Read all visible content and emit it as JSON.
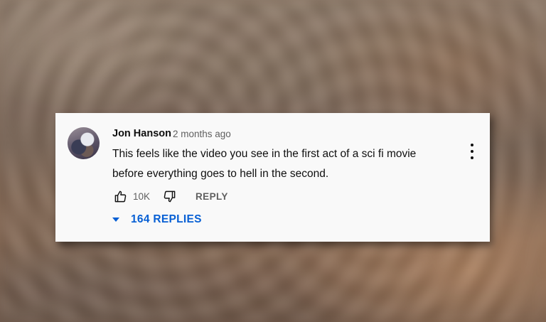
{
  "comment": {
    "author": "Jon Hanson",
    "timestamp": "2 months ago",
    "text": "This feels like the video you see in the first act of a sci fi movie before everything goes to hell in the second.",
    "like_count": "10K",
    "reply_label": "REPLY",
    "replies_label": "164 REPLIES",
    "icons": {
      "like": "thumbs-up-icon",
      "dislike": "thumbs-down-icon",
      "menu": "more-vert-icon",
      "expand": "caret-down-icon"
    },
    "colors": {
      "link": "#065fd4",
      "secondary_text": "#606060",
      "primary_text": "#0f0f0f",
      "card_bg": "#f9f9f9"
    }
  }
}
